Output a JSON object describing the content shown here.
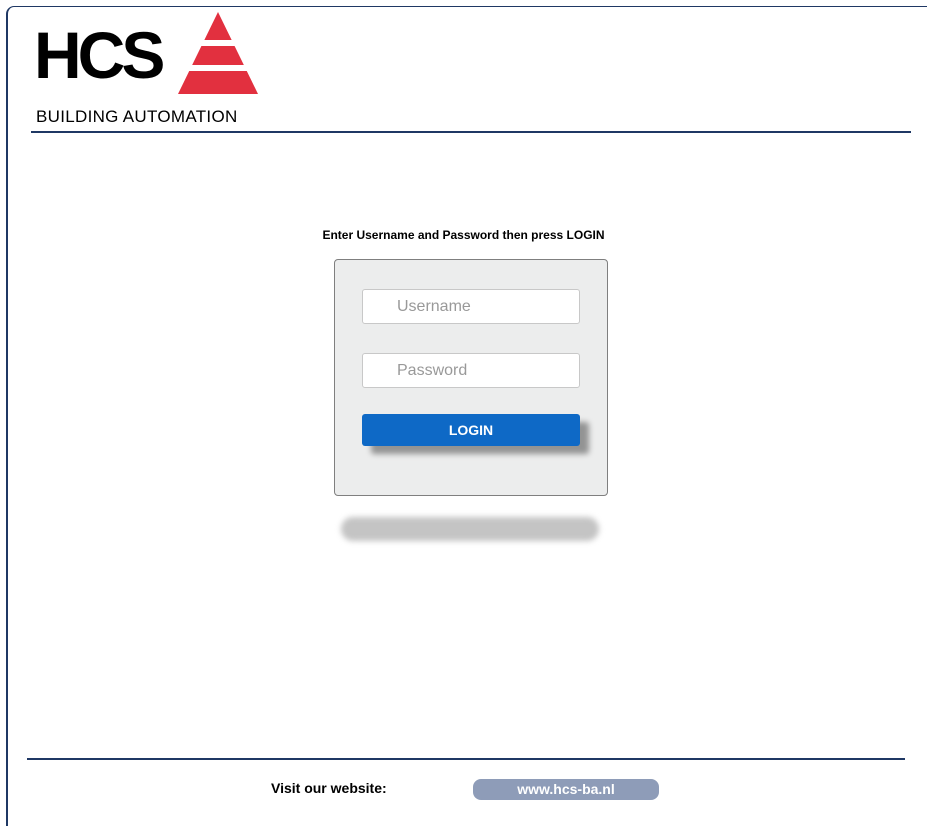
{
  "logo": {
    "wordmark": "HCS",
    "subtitle": "BUILDING AUTOMATION",
    "triangle_color": "#e2303f"
  },
  "login": {
    "instructions": "Enter Username and Password then press LOGIN",
    "username_placeholder": "Username",
    "username_value": "",
    "password_placeholder": "Password",
    "password_value": "",
    "button_label": "LOGIN",
    "button_color": "#0e69c6"
  },
  "footer": {
    "label": "Visit our website:",
    "link_text": "www.hcs-ba.nl",
    "rule_color": "#1f3864"
  }
}
